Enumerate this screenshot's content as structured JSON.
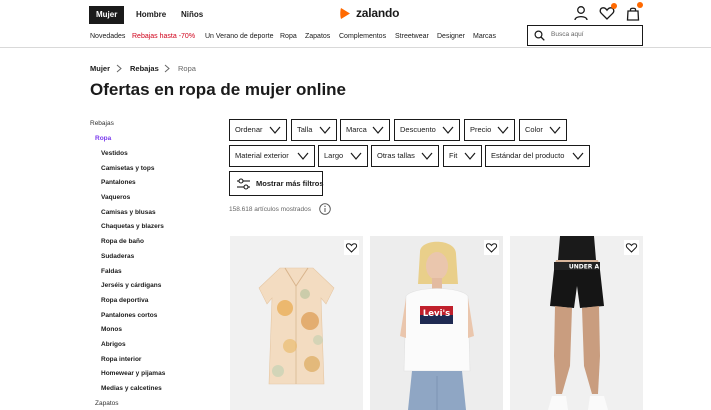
{
  "header": {
    "gender_tabs": [
      "Mujer",
      "Hombre",
      "Niños"
    ],
    "logo_text": "zalando",
    "icons": [
      "user-icon",
      "heart-icon",
      "bag-icon"
    ],
    "accent_color": "#ff6900"
  },
  "nav": {
    "items": [
      "Novedades",
      "Rebajas hasta -70%",
      "Un Verano de deporte",
      "Ropa",
      "Zapatos",
      "Complementos",
      "Streetwear",
      "Designer",
      "Marcas"
    ],
    "sale_color": "#d0021b"
  },
  "search": {
    "placeholder": "Busca aquí"
  },
  "breadcrumb": [
    "Mujer",
    "Rebajas",
    "Ropa"
  ],
  "page_title": "Ofertas en ropa de mujer online",
  "sidebar": {
    "top": "Rebajas",
    "category": "Ropa",
    "items": [
      "Vestidos",
      "Camisetas y tops",
      "Pantalones",
      "Vaqueros",
      "Camisas y blusas",
      "Chaquetas y blazers",
      "Ropa de baño",
      "Sudaderas",
      "Faldas",
      "Jerséis y cárdigans",
      "Ropa deportiva",
      "Pantalones cortos",
      "Monos",
      "Abrigos",
      "Ropa interior",
      "Homewear y pijamas",
      "Medias y calcetines"
    ],
    "next": "Zapatos"
  },
  "filters": {
    "row1": [
      "Ordenar",
      "Talla",
      "Marca",
      "Descuento",
      "Precio",
      "Color"
    ],
    "row2": [
      "Material exterior",
      "Largo",
      "Otras tallas",
      "Fit",
      "Estándar del producto"
    ],
    "more": "Mostrar más filtros"
  },
  "results_count": "158.618 artículos mostrados",
  "products": [
    {
      "name": "product-kimono"
    },
    {
      "name": "product-levis-tshirt",
      "logo_text": "Levi's"
    },
    {
      "name": "product-shorts",
      "band_text": "UNDER A"
    }
  ]
}
